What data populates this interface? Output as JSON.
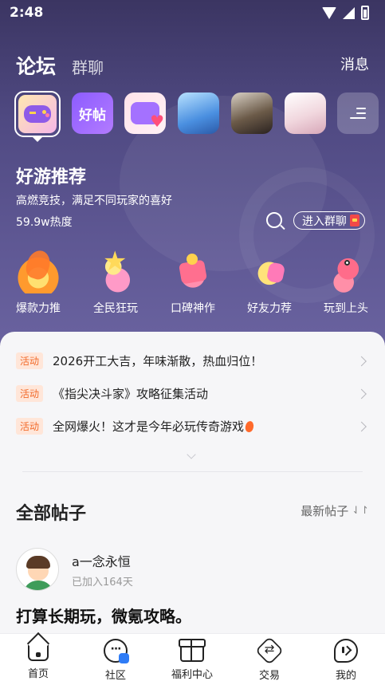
{
  "status_bar": {
    "time": "2:48"
  },
  "header": {
    "tabs": [
      {
        "label": "论坛"
      },
      {
        "label": "群聊"
      }
    ],
    "messages_label": "消息"
  },
  "game_icons": [
    {
      "name": "gamepad-app",
      "caption": ""
    },
    {
      "name": "haotie",
      "caption": "好帖"
    },
    {
      "name": "chat-heart-app",
      "caption": ""
    },
    {
      "name": "game-2",
      "caption": ""
    },
    {
      "name": "game-3",
      "caption": ""
    },
    {
      "name": "game-4",
      "caption": ""
    }
  ],
  "recommend": {
    "title": "好游推荐",
    "description": "高燃竞技，满足不同玩家的喜好",
    "heat": "59.9w热度",
    "join_label": "进入群聊"
  },
  "categories": [
    {
      "label": "爆款力推"
    },
    {
      "label": "全民狂玩"
    },
    {
      "label": "口碑神作"
    },
    {
      "label": "好友力荐"
    },
    {
      "label": "玩到上头"
    }
  ],
  "activities": [
    {
      "tag": "活动",
      "text": "2026开工大吉，年味渐散，热血归位！"
    },
    {
      "tag": "活动",
      "text": "《指尖决斗家》攻略征集活动"
    },
    {
      "tag": "活动",
      "text": "全网爆火！这才是今年必玩传奇游戏"
    }
  ],
  "posts_section": {
    "title": "全部帖子",
    "sort_label": "最新帖子",
    "sort_icon": "⇃↾"
  },
  "post": {
    "author": "a一念永恒",
    "joined": "已加入164天",
    "title": "打算长期玩，微氪攻略。"
  },
  "bottom_nav": [
    {
      "label": "首页",
      "icon": "home-icon"
    },
    {
      "label": "社区",
      "icon": "community-icon"
    },
    {
      "label": "福利中心",
      "icon": "gift-icon"
    },
    {
      "label": "交易",
      "icon": "trade-icon"
    },
    {
      "label": "我的",
      "icon": "mine-icon"
    }
  ],
  "colors": {
    "hero_bg": "#504a83",
    "activity_tag": "#f26b2b",
    "activity_tag_bg": "#ffe6d9",
    "community_badge": "#2f7cf6"
  }
}
